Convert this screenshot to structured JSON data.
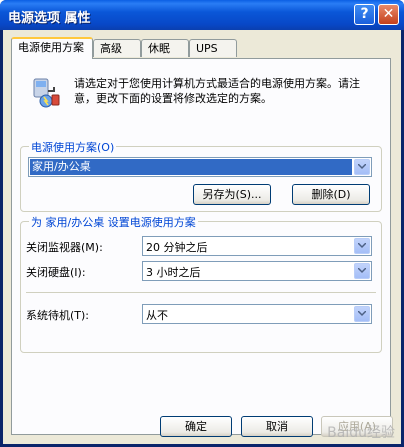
{
  "window": {
    "title": "电源选项 属性",
    "help_glyph": "?",
    "close_glyph": "✕"
  },
  "tabs": [
    {
      "label": "电源使用方案",
      "active": true
    },
    {
      "label": "高级",
      "active": false
    },
    {
      "label": "休眠",
      "active": false
    },
    {
      "label": "UPS",
      "active": false
    }
  ],
  "intro": {
    "icon": "power-scheme-icon",
    "text": "请选定对于您使用计算机方式最适合的电源使用方案。请注意，更改下面的设置将修改选定的方案。"
  },
  "scheme_group": {
    "title": "电源使用方案(O)",
    "selected": "家用/办公桌",
    "save_as_label": "另存为(S)...",
    "delete_label": "删除(D)"
  },
  "settings_group": {
    "title": "为 家用/办公桌 设置电源使用方案",
    "monitor_label": "关闭监视器(M):",
    "monitor_value": "20 分钟之后",
    "disk_label": "关闭硬盘(I):",
    "disk_value": "3 小时之后",
    "standby_label": "系统待机(T):",
    "standby_value": "从不"
  },
  "footer": {
    "ok_label": "确定",
    "cancel_label": "取消",
    "apply_label": "应用(A)"
  },
  "watermark": "Baidu经验"
}
